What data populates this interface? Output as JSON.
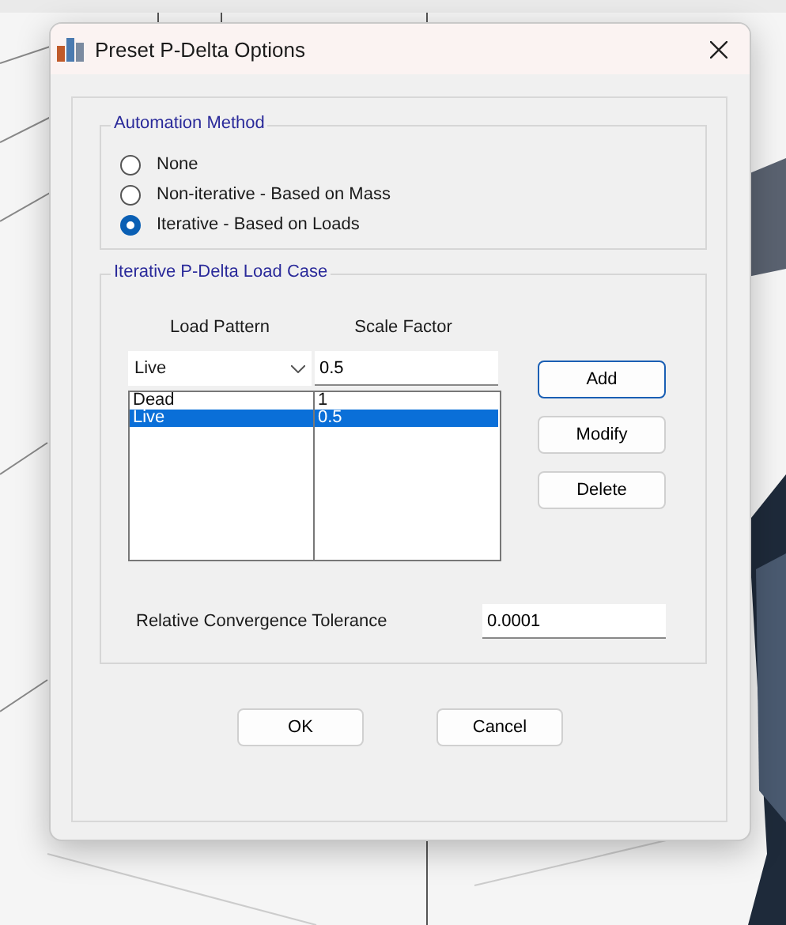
{
  "window": {
    "title": "Preset P-Delta Options"
  },
  "automation_method": {
    "title": "Automation Method",
    "options": [
      {
        "label": "None",
        "selected": false
      },
      {
        "label": "Non-iterative - Based on Mass",
        "selected": false
      },
      {
        "label": "Iterative - Based on Loads",
        "selected": true
      }
    ]
  },
  "load_case": {
    "title": "Iterative P-Delta Load Case",
    "columns": [
      "Load Pattern",
      "Scale Factor"
    ],
    "load_pattern": {
      "value": "Live"
    },
    "scale_factor": {
      "value": "0.5"
    },
    "rows": [
      {
        "pattern": "Dead",
        "factor": "1",
        "selected": false
      },
      {
        "pattern": "Live",
        "factor": "0.5",
        "selected": true
      }
    ],
    "buttons": [
      {
        "label": "Add",
        "focused": true
      },
      {
        "label": "Modify",
        "focused": false
      },
      {
        "label": "Delete",
        "focused": false
      }
    ],
    "tolerance": {
      "label": "Relative Convergence Tolerance",
      "value": "0.0001"
    }
  },
  "buttons": [
    "OK",
    "Cancel"
  ]
}
